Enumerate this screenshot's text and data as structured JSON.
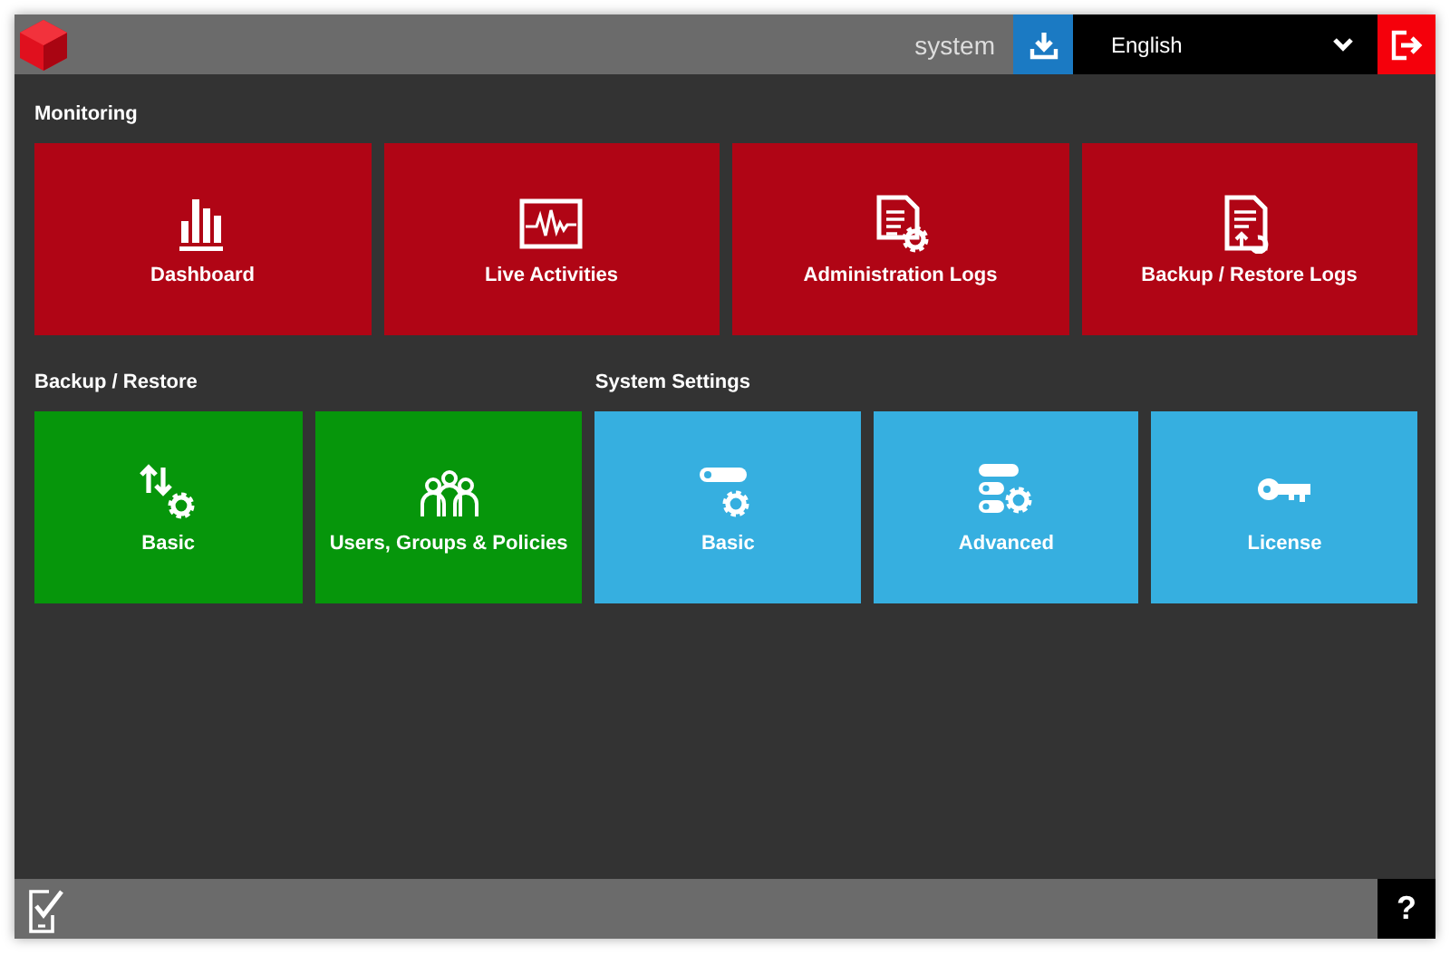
{
  "header": {
    "user": "system",
    "language": {
      "value": "English"
    }
  },
  "rows": [
    {
      "groups": [
        {
          "title": "Monitoring",
          "color": "#b00515",
          "tiles": [
            {
              "label": "Dashboard",
              "kind": "chart"
            },
            {
              "label": "Live Activities",
              "kind": "monitor"
            },
            {
              "label": "Administration Logs",
              "kind": "doc-gear"
            },
            {
              "label": "Backup / Restore Logs",
              "kind": "doc-restore"
            }
          ]
        }
      ]
    },
    {
      "groups": [
        {
          "title": "Backup / Restore",
          "color": "#06960b",
          "tiles": [
            {
              "label": "Basic",
              "kind": "transfer-gear"
            },
            {
              "label": "Users, Groups & Policies",
              "kind": "people"
            }
          ]
        },
        {
          "title": "System Settings",
          "color": "#36afe0",
          "tiles": [
            {
              "label": "Basic",
              "kind": "toggle-gear"
            },
            {
              "label": "Advanced",
              "kind": "toggles-gear"
            },
            {
              "label": "License",
              "kind": "key"
            }
          ]
        }
      ]
    }
  ],
  "footer": {
    "help": "?"
  }
}
